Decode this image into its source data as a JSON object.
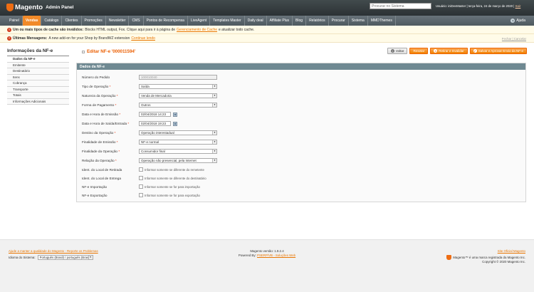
{
  "header": {
    "logo_text": "Magento",
    "logo_sub": "Admin Panel",
    "search_placeholder": "Procurar no Sistema",
    "user_text": "Usuário: iniDevMaster  |  terça-feira, 24 de março de 2020  |",
    "logout": "Sair"
  },
  "nav": {
    "items": [
      "Painel",
      "Vendas",
      "Catálogo",
      "Clientes",
      "Promoções",
      "Newsletter",
      "CMS",
      "Pontos de Recompensa",
      "LiveAgent",
      "Templates Master",
      "Daily deal",
      "Affiliate Plus",
      "Blog",
      "Relatórios",
      "Procurar",
      "Sistema",
      "MMDThemes"
    ],
    "active": "Vendas",
    "help": "Ajuda"
  },
  "messages": {
    "m1_bold": "Um ou mais tipos de cache são inválidos:",
    "m1_text": "Blocks HTML output, Fox. Clique aqui para ir à página de",
    "m1_link": "Gerenciamento de Cache",
    "m1_tail": "e atualizar todo cache.",
    "m2_bold": "Últimas Mensagens:",
    "m2_text": "A new add-on for your Shop by BrandWZ extension",
    "m2_link": "Continue lendo",
    "m2_actions": "Fechar  |  Cancelar"
  },
  "sidebar": {
    "title": "Informações da NF-e",
    "items": [
      "Dados da NF-e",
      "Emitente",
      "Destinatário",
      "Itens",
      "Cobrança",
      "Transporte",
      "Totais",
      "Informações Adicionais"
    ]
  },
  "page": {
    "title": "Editar NF-e '000011594'",
    "buttons": {
      "back": "Voltar",
      "reset": "Resetar",
      "delete": "Retirar e Invalidar",
      "save": "Salvar e Aprovar Envio da NF-e"
    }
  },
  "form": {
    "legend": "Dados da NF-e",
    "fields": {
      "numero_label": "Número do Pedido",
      "numero_value": "100010040",
      "tipo_label": "Tipo de Operação",
      "tipo_value": "Saída",
      "natureza_label": "Natureza da Operação",
      "natureza_value": "Venda de Mercadoria",
      "pagamento_label": "Forma de Pagamento",
      "pagamento_value": "Outros",
      "emissao_label": "Data e Hora de Emissão",
      "emissao_value": "02/04/2018 14:23",
      "saida_label": "Data e Hora de Saída/Entrada",
      "saida_value": "02/04/2018 19:23",
      "destino_label": "Destino da Operação",
      "destino_value": "Operação interestadual",
      "finalidade_label": "Finalidade de Emissão",
      "finalidade_value": "NF-e normal",
      "final_label": "Finalidade da Operação",
      "final_value": "Consumidor final",
      "relacao_label": "Relação da Operação",
      "relacao_value": "Operação não presencial, pela Internet",
      "retirada_label": "Ident. do Local de Retirada",
      "retirada_text": "Informar somente se diferente do remetente",
      "entrega_label": "Ident. do Local de Entrega",
      "entrega_text": "Informar somente se diferente do destinatário",
      "importacao_label": "NF-e Importação",
      "importacao_text": "Informar somente se for para importação",
      "exportacao_label": "NF-e Exportação",
      "exportacao_text": "Informar somente se for para exportação"
    }
  },
  "footer": {
    "help_link": "Ajude a manter a qualidade do Magento - Reporte os Problemas",
    "lang_label": "Idioma do Sistema:",
    "lang_value": "Português (Brasil) / português (Brasil)",
    "version": "Magento versão: 1.9.2.4",
    "powered_label": "Powered By:",
    "powered_link": "PSERP/VB - Soluções Web",
    "official_link": "Site Oficial Magento",
    "trademark": "Magento™ é uma marca registrada da Magento Inc.",
    "copyright": "Copyright © 2020 Magento Inc."
  },
  "colors": {
    "accent": "#f18a29",
    "title": "#eb5e00",
    "legend": "#6f8992"
  }
}
